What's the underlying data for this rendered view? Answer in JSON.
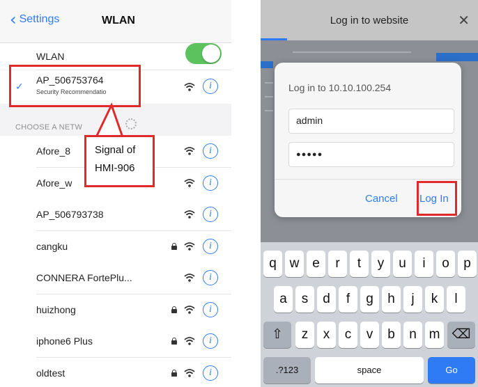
{
  "wlan_screen": {
    "nav": {
      "back_label": "Settings",
      "title": "WLAN"
    },
    "wlan_toggle": {
      "label": "WLAN",
      "state": "on"
    },
    "connected": {
      "ssid": "AP_506753764",
      "subtitle": "Security Recommendatio"
    },
    "section_header": "CHOOSE A NETW",
    "networks": [
      {
        "ssid": "Afore_8",
        "locked": false
      },
      {
        "ssid": "Afore_w",
        "locked": false
      },
      {
        "ssid": "AP_506793738",
        "locked": false
      },
      {
        "ssid": "cangku",
        "locked": true
      },
      {
        "ssid": "CONNERA FortePlu...",
        "locked": false
      },
      {
        "ssid": "huizhong",
        "locked": true
      },
      {
        "ssid": "iphone6 Plus",
        "locked": true
      },
      {
        "ssid": "oldtest",
        "locked": true
      }
    ],
    "info_glyph": "i",
    "callout": {
      "line1": "Signal  of",
      "line2": "HMI-906"
    }
  },
  "login_screen": {
    "header": {
      "title": "Log in to website",
      "close_glyph": "✕"
    },
    "dialog": {
      "message": "Log in to 10.10.100.254",
      "username_value": "admin",
      "password_value": "●●●●●",
      "cancel_label": "Cancel",
      "login_label": "Log In"
    },
    "keyboard": {
      "row1": [
        "q",
        "w",
        "e",
        "r",
        "t",
        "y",
        "u",
        "i",
        "o",
        "p"
      ],
      "row2": [
        "a",
        "s",
        "d",
        "f",
        "g",
        "h",
        "j",
        "k",
        "l"
      ],
      "row3": [
        "z",
        "x",
        "c",
        "v",
        "b",
        "n",
        "m"
      ],
      "shift_glyph": "⇧",
      "delete_glyph": "⌫",
      "numbers_label": ".?123",
      "space_label": "space",
      "go_label": "Go"
    }
  },
  "colors": {
    "accent": "#2f7bf5",
    "toggle_on": "#5bc25e",
    "highlight": "#e02a2a"
  }
}
